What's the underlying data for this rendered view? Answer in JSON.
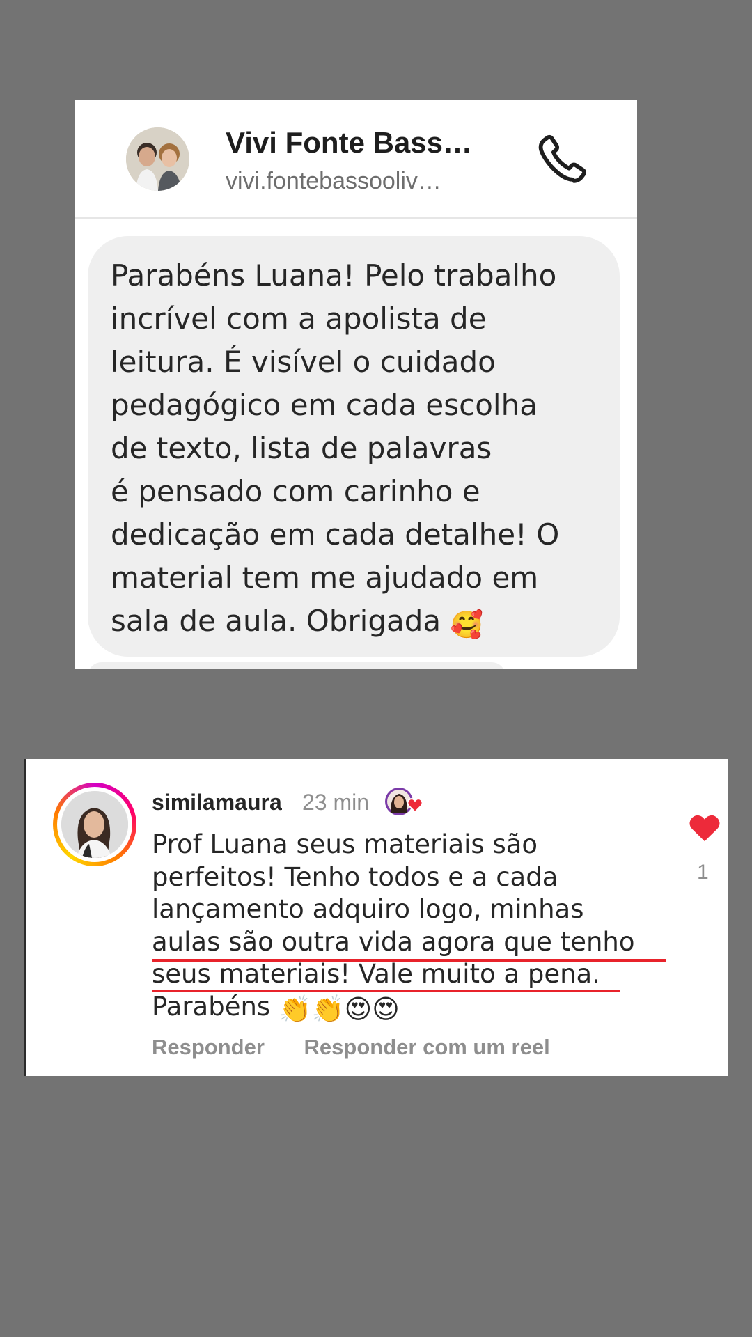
{
  "dm": {
    "contact_name": "Vivi Fonte Bass…",
    "contact_handle": "vivi.fontebassooliv…",
    "message_lines": [
      "Parabéns Luana! Pelo trabalho",
      "incrível com a apolista de",
      "leitura. É visível o cuidado",
      "pedagógico em cada escolha",
      "de texto, lista de palavras",
      "é pensado com carinho e",
      "dedicação em cada detalhe! O",
      "material tem me ajudado em",
      "sala de aula.  Obrigada"
    ],
    "message_emoji": "🥰",
    "call_icon": "phone-icon"
  },
  "comment": {
    "username": "similamaura",
    "time": "23 min",
    "body_lines": [
      "Prof Luana seus materiais são",
      "perfeitos! Tenho todos e a cada",
      "lançamento adquiro logo, minhas",
      "aulas são outra vida agora que tenho",
      "seus materiais! Vale muito a pena.",
      "Parabéns"
    ],
    "body_emojis": "👏👏😍😍",
    "like_count": "1",
    "reply_label": "Responder",
    "reply_reel_label": "Responder com um reel",
    "underline_color": "#e8232b",
    "like_color": "#ed2a3a"
  }
}
